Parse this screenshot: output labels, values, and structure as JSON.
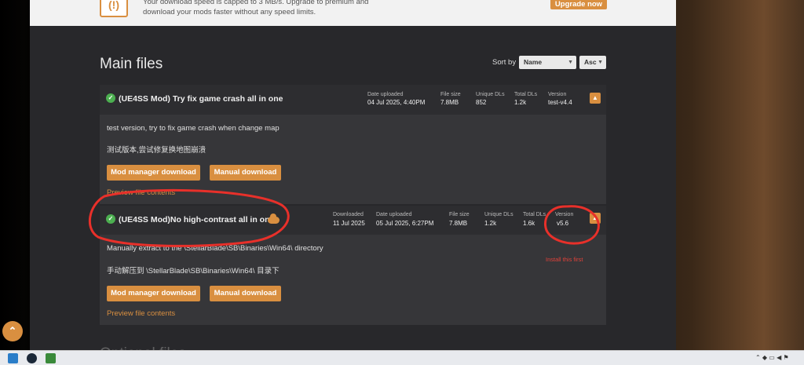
{
  "banner": {
    "icon": "speed-warning-icon",
    "line1": "Your download speed is capped to 3 MB/s. Upgrade to premium and",
    "line2": "download your mods faster without any speed limits.",
    "upgrade_label": "Upgrade now"
  },
  "section": {
    "title": "Main files",
    "sort_label": "Sort by",
    "sort_field": "Name",
    "sort_order": "Asc",
    "next_title": "Optional files"
  },
  "files": [
    {
      "name": "(UE4SS Mod) Try fix game crash all in one",
      "date_uploaded_label": "Date uploaded",
      "date_uploaded": "04 Jul 2025, 4:40PM",
      "file_size_label": "File size",
      "file_size": "7.8MB",
      "unique_dls_label": "Unique DLs",
      "unique_dls": "852",
      "total_dls_label": "Total DLs",
      "total_dls": "1.2k",
      "version_label": "Version",
      "version": "test-v4.4",
      "desc1": "test version, try to fix game crash when change map",
      "desc2": "测试版本,尝试修复换地图崩溃",
      "mod_manager_label": "Mod manager download",
      "manual_label": "Manual download",
      "preview_label": "Preview file contents"
    },
    {
      "name": "(UE4SS Mod)No high-contrast all in one",
      "downloaded_label": "Downloaded",
      "downloaded": "11 Jul 2025",
      "date_uploaded_label": "Date uploaded",
      "date_uploaded": "05 Jul 2025, 6:27PM",
      "file_size_label": "File size",
      "file_size": "7.8MB",
      "unique_dls_label": "Unique DLs",
      "unique_dls": "1.2k",
      "total_dls_label": "Total DLs",
      "total_dls": "1.6k",
      "version_label": "Version",
      "version": "v5.6",
      "desc1": "Manually extract to the \\StellarBlade\\SB\\Binaries\\Win64\\ directory",
      "desc2": "手动解压到 \\StellarBlade\\SB\\Binaries\\Win64\\ 目录下",
      "mod_manager_label": "Mod manager download",
      "manual_label": "Manual download",
      "preview_label": "Preview file contents"
    }
  ],
  "annotations": {
    "note": "Install this first",
    "color": "#e0423a"
  },
  "colors": {
    "accent": "#d98f40",
    "check": "#4caf50",
    "panel": "#28282b"
  }
}
